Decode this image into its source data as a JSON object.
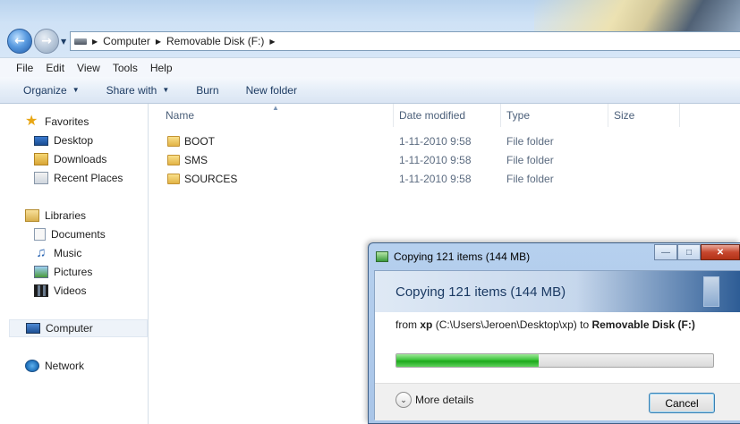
{
  "address": {
    "crumbs": [
      "Computer",
      "Removable Disk (F:)"
    ]
  },
  "menu": [
    "File",
    "Edit",
    "View",
    "Tools",
    "Help"
  ],
  "toolbar": {
    "organize": "Organize",
    "share_with": "Share with",
    "burn": "Burn",
    "new_folder": "New folder"
  },
  "nav": {
    "favorites": "Favorites",
    "desktop": "Desktop",
    "downloads": "Downloads",
    "recent_places": "Recent Places",
    "libraries": "Libraries",
    "documents": "Documents",
    "music": "Music",
    "pictures": "Pictures",
    "videos": "Videos",
    "computer": "Computer",
    "network": "Network"
  },
  "columns": {
    "name": "Name",
    "date_modified": "Date modified",
    "type": "Type",
    "size": "Size"
  },
  "files": [
    {
      "name": "BOOT",
      "date": "1-11-2010 9:58",
      "type": "File folder"
    },
    {
      "name": "SMS",
      "date": "1-11-2010 9:58",
      "type": "File folder"
    },
    {
      "name": "SOURCES",
      "date": "1-11-2010 9:58",
      "type": "File folder"
    }
  ],
  "dialog": {
    "title": "Copying 121 items (144 MB)",
    "heading": "Copying 121 items (144 MB)",
    "from_label": "from",
    "source_name": "xp",
    "source_path": "(C:\\Users\\Jeroen\\Desktop\\xp)",
    "to_label": "to",
    "destination": "Removable Disk (F:)",
    "progress_fraction": 0.45,
    "more_details": "More details",
    "cancel": "Cancel"
  }
}
